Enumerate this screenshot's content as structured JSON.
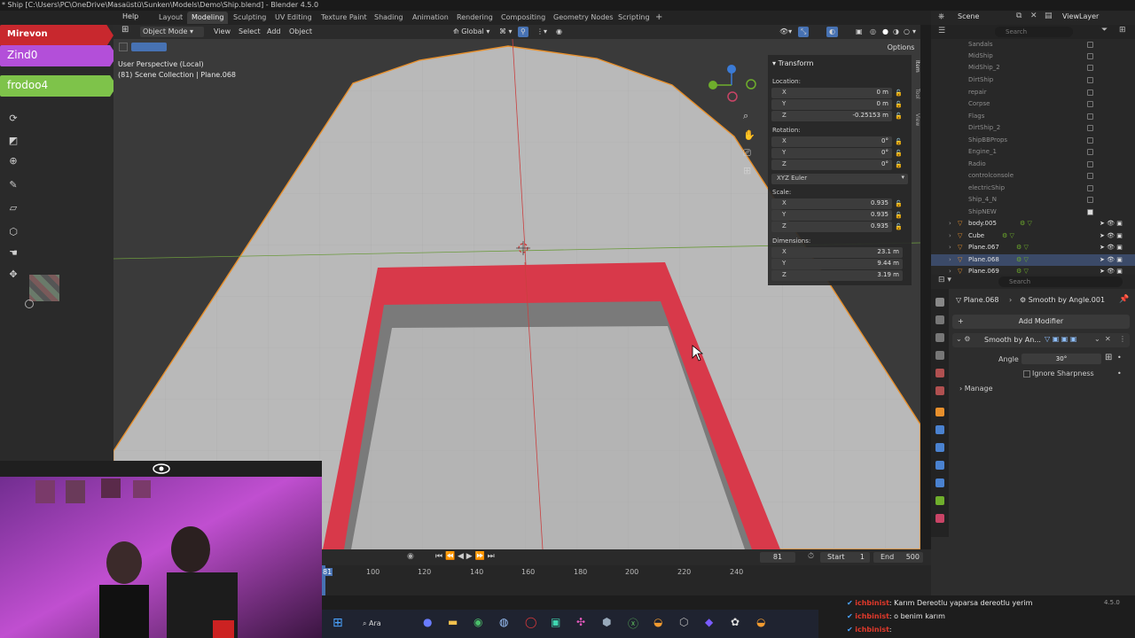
{
  "window": {
    "title": "* Ship [C:\\Users\\PC\\OneDrive\\Masaüstü\\Sunken\\Models\\Demo\\Ship.blend] - Blender 4.5.0"
  },
  "menu": {
    "help": "Help"
  },
  "workspaces": [
    "Layout",
    "Modeling",
    "Sculpting",
    "UV Editing",
    "Texture Paint",
    "Shading",
    "Animation",
    "Rendering",
    "Compositing",
    "Geometry Nodes",
    "Scripting"
  ],
  "workspace_add": "+",
  "stream_banners": [
    {
      "label": "Mirevon",
      "color": "#c8282e"
    },
    {
      "label": "Zind0",
      "color": "#b34fd9"
    },
    {
      "label": "frodoo4",
      "color": "#7ec34a"
    }
  ],
  "viewport_header": {
    "mode": "Object Mode",
    "view": "View",
    "select": "Select",
    "add": "Add",
    "object": "Object",
    "orientation": "Global",
    "options": "Options"
  },
  "viewport_overlay": {
    "perspective": "User Perspective (Local)",
    "collection": "(81) Scene Collection | Plane.068"
  },
  "transform_panel": {
    "title": "Transform",
    "location_label": "Location:",
    "location": {
      "x": "0 m",
      "y": "0 m",
      "z": "-0.25153 m"
    },
    "rotation_label": "Rotation:",
    "rotation": {
      "x": "0°",
      "y": "0°",
      "z": "0°"
    },
    "rotation_mode": "XYZ Euler",
    "scale_label": "Scale:",
    "scale": {
      "x": "0.935",
      "y": "0.935",
      "z": "0.935"
    },
    "dimensions_label": "Dimensions:",
    "dimensions": {
      "x": "23.1 m",
      "y": "9.44 m",
      "z": "3.19 m"
    },
    "axis_x": "X",
    "axis_y": "Y",
    "axis_z": "Z"
  },
  "sidebar_tabs": [
    "Item",
    "Tool",
    "View"
  ],
  "outliner": {
    "scene": "Scene",
    "view_layer": "ViewLayer",
    "search_placeholder": "Search",
    "items": [
      {
        "name": "Sandals",
        "visible": false
      },
      {
        "name": "MidShip",
        "visible": false
      },
      {
        "name": "MidShip_2",
        "visible": false
      },
      {
        "name": "DirtShip",
        "visible": false
      },
      {
        "name": "repair",
        "visible": false
      },
      {
        "name": "Corpse",
        "visible": false
      },
      {
        "name": "Flags",
        "visible": false
      },
      {
        "name": "DirtShip_2",
        "visible": false
      },
      {
        "name": "ShipBBProps",
        "visible": false
      },
      {
        "name": "Engine_1",
        "visible": false
      },
      {
        "name": "Radio",
        "visible": false
      },
      {
        "name": "controlconsole",
        "visible": false
      },
      {
        "name": "electricShip",
        "visible": false
      },
      {
        "name": "Ship_4_N",
        "visible": false
      },
      {
        "name": "ShipNEW",
        "visible": false
      },
      {
        "name": "body.005",
        "visible": true
      },
      {
        "name": "Cube",
        "visible": true
      },
      {
        "name": "Plane.067",
        "visible": true
      },
      {
        "name": "Plane.068",
        "visible": true,
        "selected": true
      },
      {
        "name": "Plane.069",
        "visible": true
      }
    ]
  },
  "properties": {
    "search_placeholder": "Search",
    "object": "Plane.068",
    "modifier_path": "Smooth by Angle.001",
    "add_modifier": "Add Modifier",
    "modifier_name": "Smooth by An...",
    "angle_label": "Angle",
    "angle_value": "30°",
    "ignore_sharpness": "Ignore Sharpness",
    "manage": "Manage"
  },
  "timeline": {
    "current_frame": "81",
    "start_label": "Start",
    "start": "1",
    "end_label": "End",
    "end": "500",
    "ticks": [
      "100",
      "120",
      "140",
      "160",
      "180",
      "200",
      "220",
      "240"
    ],
    "cursor": "81"
  },
  "taskbar": {
    "search": "Ara"
  },
  "chat": [
    {
      "user": "ichbinist",
      "message": ": Karım Dereotlu yaparsa dereotlu yerim"
    },
    {
      "user": "ichbinist",
      "message": ": o benim karım"
    },
    {
      "user": "ichbinist",
      "message": ":"
    }
  ],
  "version": "4.5.0",
  "colors": {
    "accent_orange": "#ff9a2e",
    "selection_blue": "#3b4a68",
    "mesh_red": "#d8394a",
    "viewport_gray": "#b9b9b9"
  }
}
